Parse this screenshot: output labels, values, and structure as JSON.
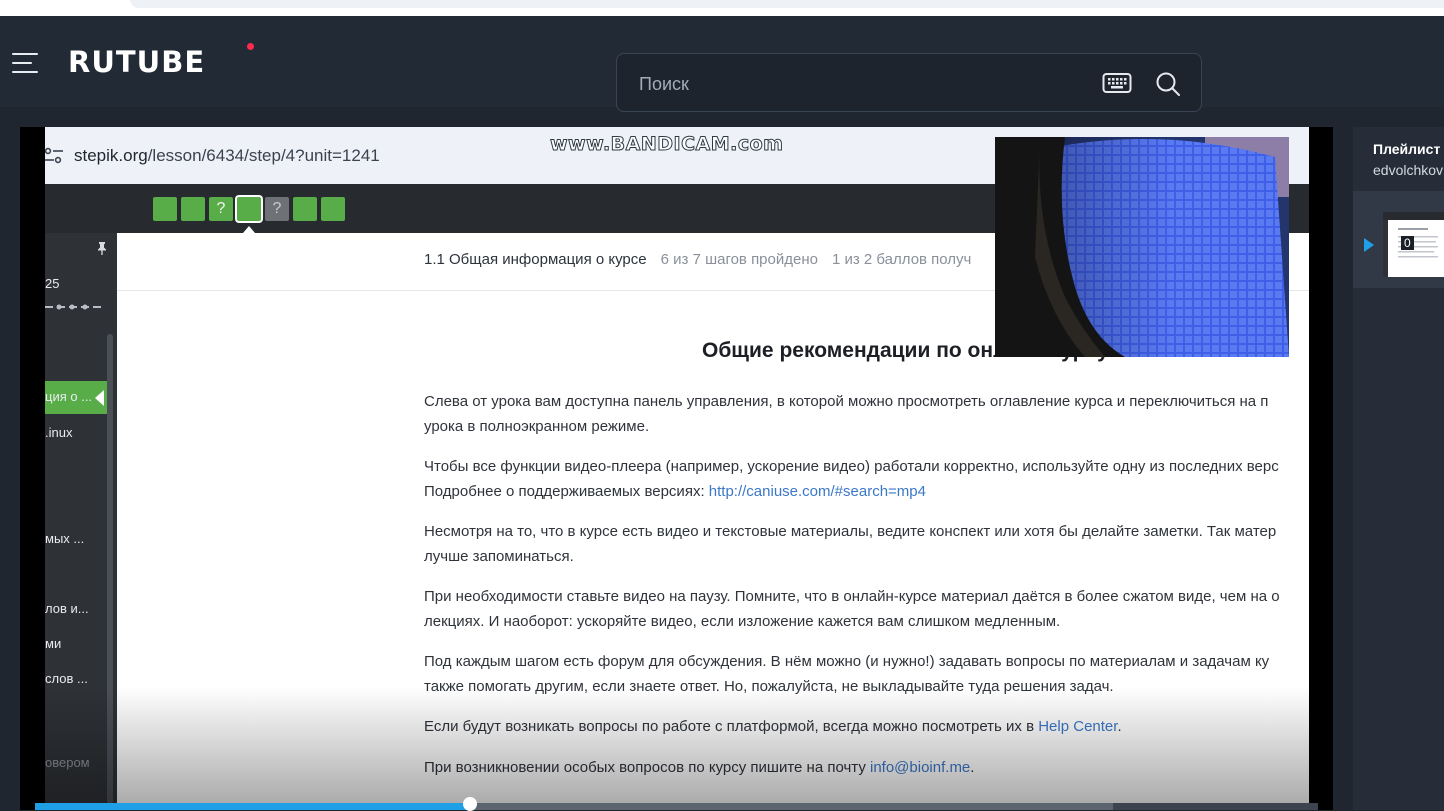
{
  "header": {
    "logo": "RUTUBE",
    "search": {
      "placeholder": "Поиск",
      "value": ""
    }
  },
  "video": {
    "url_domain": "stepik.org",
    "url_path": "/lesson/6434/step/4?unit=1241",
    "watermark": "www.BANDICAM.com",
    "steps": [
      {
        "label": "",
        "state": "done"
      },
      {
        "label": "",
        "state": "done"
      },
      {
        "label": "?",
        "state": "done"
      },
      {
        "label": "",
        "state": "active"
      },
      {
        "label": "?",
        "state": "pending"
      },
      {
        "label": "",
        "state": "done"
      },
      {
        "label": "",
        "state": "done"
      }
    ],
    "sidebar": {
      "counter": "25",
      "items": [
        "ция о ...",
        ".inux",
        "мых ...",
        "лов и...",
        "ми",
        "слов ...",
        "овером"
      ]
    },
    "breadcrumb": {
      "lesson": "1.1 Общая информация о курсе",
      "steps_passed": "6 из 7 шагов пройдено",
      "points": "1 из 2 баллов  получ"
    },
    "heading": "Общие рекомендации по онлайн-курсу",
    "paragraphs": [
      {
        "line1": "Слева от урока вам доступна панель управления, в которой можно просмотреть оглавление курса и переключиться на п",
        "line2": "урока в полноэкранном режиме."
      },
      {
        "line1": "Чтобы все функции видео-плеера (например, ускорение видео) работали корректно, используйте одну из последних верс",
        "line2_prefix": "Подробнее о поддерживаемых версиях: ",
        "line2_link": "http://caniuse.com/#search=mp4"
      },
      {
        "line1": "Несмотря на то, что в курсе есть видео и текстовые материалы, ведите конспект или хотя бы делайте заметки. Так матер",
        "line2": "лучше запоминаться."
      },
      {
        "line1": "При необходимости ставьте видео на паузу. Помните, что в онлайн-курсе материал даётся в более сжатом виде, чем на о",
        "line2": "лекциях. И наоборот: ускоряйте видео, если изложение кажется вам слишком медленным."
      },
      {
        "line1": "Под каждым шагом есть форум для обсуждения. В нём можно (и нужно!) задавать вопросы по материалам и задачам ку",
        "line2": "также помогать другим, если знаете ответ. Но, пожалуйста, не выкладывайте туда решения задач."
      },
      {
        "line1_prefix": "Если будут возникать вопросы по работе с платформой, всегда можно посмотреть их в ",
        "line1_link": "Help Center",
        "line1_suffix": "."
      },
      {
        "line1_prefix": "При возникновении особых вопросов по курсу пишите на почту ",
        "line1_link": "info@bioinf.me",
        "line1_suffix": "."
      }
    ]
  },
  "player": {
    "progress": 0.339
  },
  "playlist": {
    "title": "Плейлист",
    "owner": "edvolchkov",
    "current_duration": "0"
  },
  "colors": {
    "header_bg": "#222a35",
    "accent_blue": "#1e9fe6",
    "stepik_green": "#58ad49",
    "logo_dot": "#ff2b4e"
  }
}
